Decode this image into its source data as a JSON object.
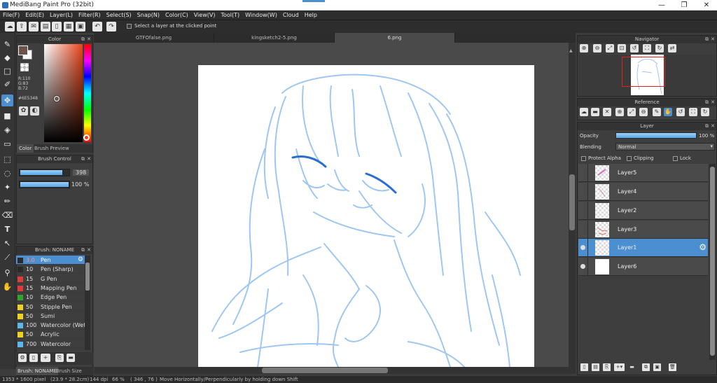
{
  "window": {
    "title": "MediBang Paint Pro (32bit)",
    "minimize": "—",
    "restore": "❐",
    "close": "✕"
  },
  "menu": [
    "File(F)",
    "Edit(E)",
    "Layer(L)",
    "Filter(R)",
    "Select(S)",
    "Snap(N)",
    "Color(C)",
    "View(V)",
    "Tool(T)",
    "Window(W)",
    "Cloud",
    "Help"
  ],
  "toolbar": {
    "hint": "Select a layer at the clicked point"
  },
  "color_panel": {
    "title": "Color",
    "r": "R:110",
    "g": "G:83",
    "b": "B:72",
    "hex": "#6E5348",
    "tab_color": "Color",
    "tab_preview": "Brush Preview",
    "main_color": "#6e5348"
  },
  "brush_control": {
    "title": "Brush Control",
    "size": "398",
    "opacity": "100 %",
    "size_fraction": 0.87,
    "opacity_fraction": 1.0
  },
  "brush_panel": {
    "title": "Brush: NONAME",
    "items": [
      {
        "size": "3.0",
        "name": "Pen",
        "color": "#2a2a2a"
      },
      {
        "size": "10",
        "name": "Pen (Sharp)",
        "color": "#2a2a2a"
      },
      {
        "size": "15",
        "name": "G Pen",
        "color": "#e03a3a"
      },
      {
        "size": "15",
        "name": "Mapping Pen",
        "color": "#e03a3a"
      },
      {
        "size": "10",
        "name": "Edge Pen",
        "color": "#2fa52f"
      },
      {
        "size": "50",
        "name": "Stipple Pen",
        "color": "#f0d21e"
      },
      {
        "size": "50",
        "name": "Sumi",
        "color": "#f0d21e"
      },
      {
        "size": "100",
        "name": "Watercolor (Wet)",
        "color": "#5bb8ee"
      },
      {
        "size": "50",
        "name": "Acrylic",
        "color": "#f0d21e"
      },
      {
        "size": "700",
        "name": "Watercolor",
        "color": "#5bb8ee"
      }
    ],
    "tab_brush": "Brush: NONAME",
    "tab_size": "Brush Size"
  },
  "tabs": [
    "GTFOfalse.png",
    "kingsketch2-5.png",
    "6.png"
  ],
  "navigator": {
    "title": "Navigator"
  },
  "reference": {
    "title": "Reference"
  },
  "layer_panel": {
    "title": "Layer",
    "opacity_label": "Opacity",
    "opacity_value": "100 %",
    "blending_label": "Blending",
    "blending_value": "Normal",
    "protect_alpha": "Protect Alpha",
    "clipping": "Clipping",
    "lock": "Lock",
    "layers": [
      "Layer5",
      "Layer4",
      "Layer2",
      "Layer3",
      "Layer1",
      "Layer6"
    ]
  },
  "status": {
    "size": "1353 * 1600 pixel",
    "cm": "(23.9 * 28.2cm)",
    "dpi": "144 dpi",
    "zoom": "66 %",
    "coords": "( 346 , 76 )",
    "hint": "Move Horizontally/Perpendicularly by holding down Shift"
  }
}
